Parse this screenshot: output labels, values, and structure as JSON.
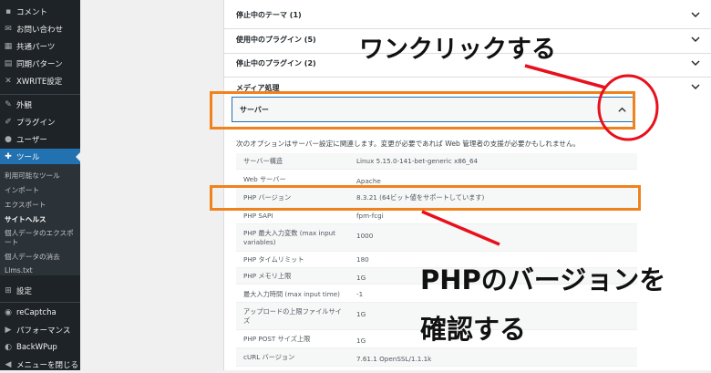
{
  "sidebar": {
    "items": [
      {
        "label": "コメント",
        "icon": "comment-icon",
        "glyph": "▪"
      },
      {
        "label": "お問い合わせ",
        "icon": "mail-icon",
        "glyph": "✉"
      },
      {
        "label": "共通パーツ",
        "icon": "parts-icon",
        "glyph": "▦"
      },
      {
        "label": "同期パターン",
        "icon": "pattern-icon",
        "glyph": "▤"
      },
      {
        "label": "XWRITE設定",
        "icon": "xwrite-icon",
        "glyph": "✕"
      },
      {
        "label": "外観",
        "icon": "brush-icon",
        "glyph": "✎"
      },
      {
        "label": "プラグイン",
        "icon": "plugin-icon",
        "glyph": "✐"
      },
      {
        "label": "ユーザー",
        "icon": "user-icon",
        "glyph": "●"
      },
      {
        "label": "ツール",
        "icon": "wrench-icon",
        "glyph": "✚"
      }
    ],
    "submenu": [
      "利用可能なツール",
      "インポート",
      "エクスポート",
      "サイトヘルス",
      "個人データのエクスポート",
      "個人データの消去",
      "Llms.txt"
    ],
    "bottom_items": [
      {
        "label": "設定",
        "icon": "settings-icon",
        "glyph": "⊞"
      },
      {
        "label": "reCaptcha",
        "icon": "recaptcha-icon",
        "glyph": "◉"
      },
      {
        "label": "パフォーマンス",
        "icon": "performance-icon",
        "glyph": "▶"
      },
      {
        "label": "BackWPup",
        "icon": "backup-icon",
        "glyph": "◐"
      },
      {
        "label": "メニューを閉じる",
        "icon": "collapse-icon",
        "glyph": "◀"
      }
    ]
  },
  "accordion": {
    "rows": [
      "停止中のテーマ (1)",
      "使用中のプラグイン (5)",
      "停止中のプラグイン (2)",
      "メディア処理"
    ],
    "server_label": "サーバー"
  },
  "server": {
    "description": "次のオプションはサーバー設定に関連します。変更が必要であれば Web 管理者の支援が必要かもしれません。",
    "rows": [
      {
        "key": "サーバー構造",
        "value": "Linux 5.15.0-141-bet-generic x86_64"
      },
      {
        "key": "Web サーバー",
        "value": "Apache"
      },
      {
        "key": "PHP バージョン",
        "value": "8.3.21 (64ビット値をサポートしています)"
      },
      {
        "key": "PHP SAPI",
        "value": "fpm-fcgi"
      },
      {
        "key": "PHP 最大入力変数 (max input variables)",
        "value": "1000"
      },
      {
        "key": "PHP タイムリミット",
        "value": "180"
      },
      {
        "key": "PHP メモリ上限",
        "value": "1G"
      },
      {
        "key": "最大入力時間 (max input time)",
        "value": "-1"
      },
      {
        "key": "アップロードの上限ファイルサイズ",
        "value": "1G"
      },
      {
        "key": "PHP POST サイズ上限",
        "value": "1G"
      },
      {
        "key": "cURL バージョン",
        "value": "7.61.1 OpenSSL/1.1.1k"
      }
    ]
  },
  "annotations": {
    "one_click": "ワンクリックする",
    "check_php_line1": "PHPのバージョンを",
    "check_php_line2": "確認する"
  },
  "colors": {
    "sidebar_bg": "#1d2327",
    "active_blue": "#2271b1",
    "annotation_orange": "#f0821e",
    "annotation_red": "#e8101c"
  }
}
